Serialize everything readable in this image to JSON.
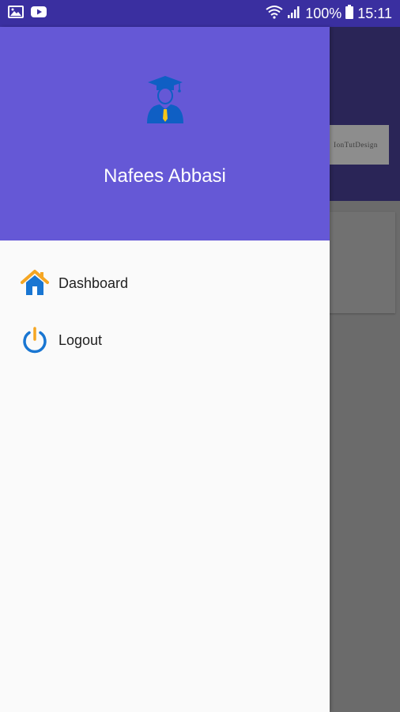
{
  "status_bar": {
    "battery": "100%",
    "time": "15:11"
  },
  "background": {
    "button_label": "IonTutDesign"
  },
  "drawer": {
    "user_name": "Nafees Abbasi",
    "menu": [
      {
        "label": "Dashboard",
        "icon": "home-icon"
      },
      {
        "label": "Logout",
        "icon": "power-icon"
      }
    ]
  },
  "colors": {
    "status_bar": "#3a2fa0",
    "drawer_header": "#6558d6",
    "home_roof": "#f5a623",
    "icon_blue": "#1976d2"
  }
}
